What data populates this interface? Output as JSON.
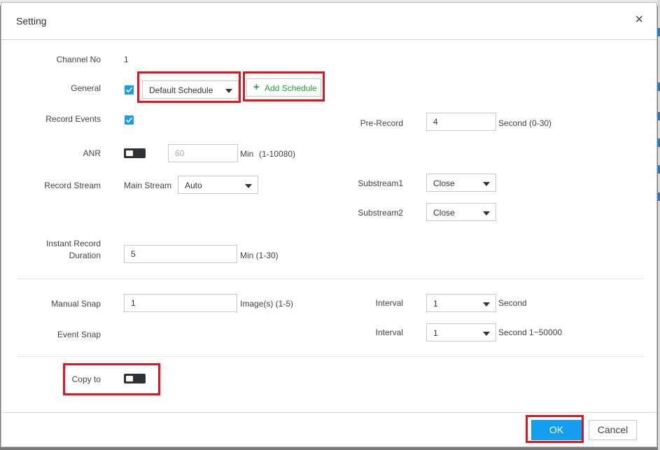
{
  "dialog": {
    "title": "Setting",
    "close_glyph": "×"
  },
  "channel": {
    "label": "Channel No",
    "value": "1"
  },
  "general": {
    "label": "General",
    "checked": true,
    "schedule_value": "Default Schedule",
    "add_schedule_label": "Add Schedule"
  },
  "record_events": {
    "label": "Record Events",
    "checked": true
  },
  "pre_record": {
    "label": "Pre-Record",
    "value": "4",
    "unit": "Second (0-30)"
  },
  "anr": {
    "label": "ANR",
    "value": "60",
    "unit": "Min",
    "range": "(1-10080)",
    "enabled": false
  },
  "record_stream": {
    "label": "Record Stream",
    "main_label": "Main Stream",
    "main_value": "Auto",
    "sub1_label": "Substream1",
    "sub1_value": "Close",
    "sub2_label": "Substream2",
    "sub2_value": "Close"
  },
  "instant_record": {
    "label_line1": "Instant Record",
    "label_line2": "Duration",
    "value": "5",
    "unit": "Min (1-30)"
  },
  "manual_snap": {
    "label": "Manual Snap",
    "value": "1",
    "unit": "Image(s) (1-5)",
    "interval_label": "Interval",
    "interval_value": "1",
    "interval_unit": "Second"
  },
  "event_snap": {
    "label": "Event Snap",
    "interval_label": "Interval",
    "interval_value": "1",
    "interval_unit": "Second 1~50000"
  },
  "copy_to": {
    "label": "Copy to",
    "enabled": false
  },
  "footer": {
    "ok_label": "OK",
    "cancel_label": "Cancel"
  },
  "colors": {
    "accent": "#139ef0",
    "checkbox": "#1c9be6",
    "add_green": "#1aa33a",
    "highlight": "#e0161e"
  }
}
